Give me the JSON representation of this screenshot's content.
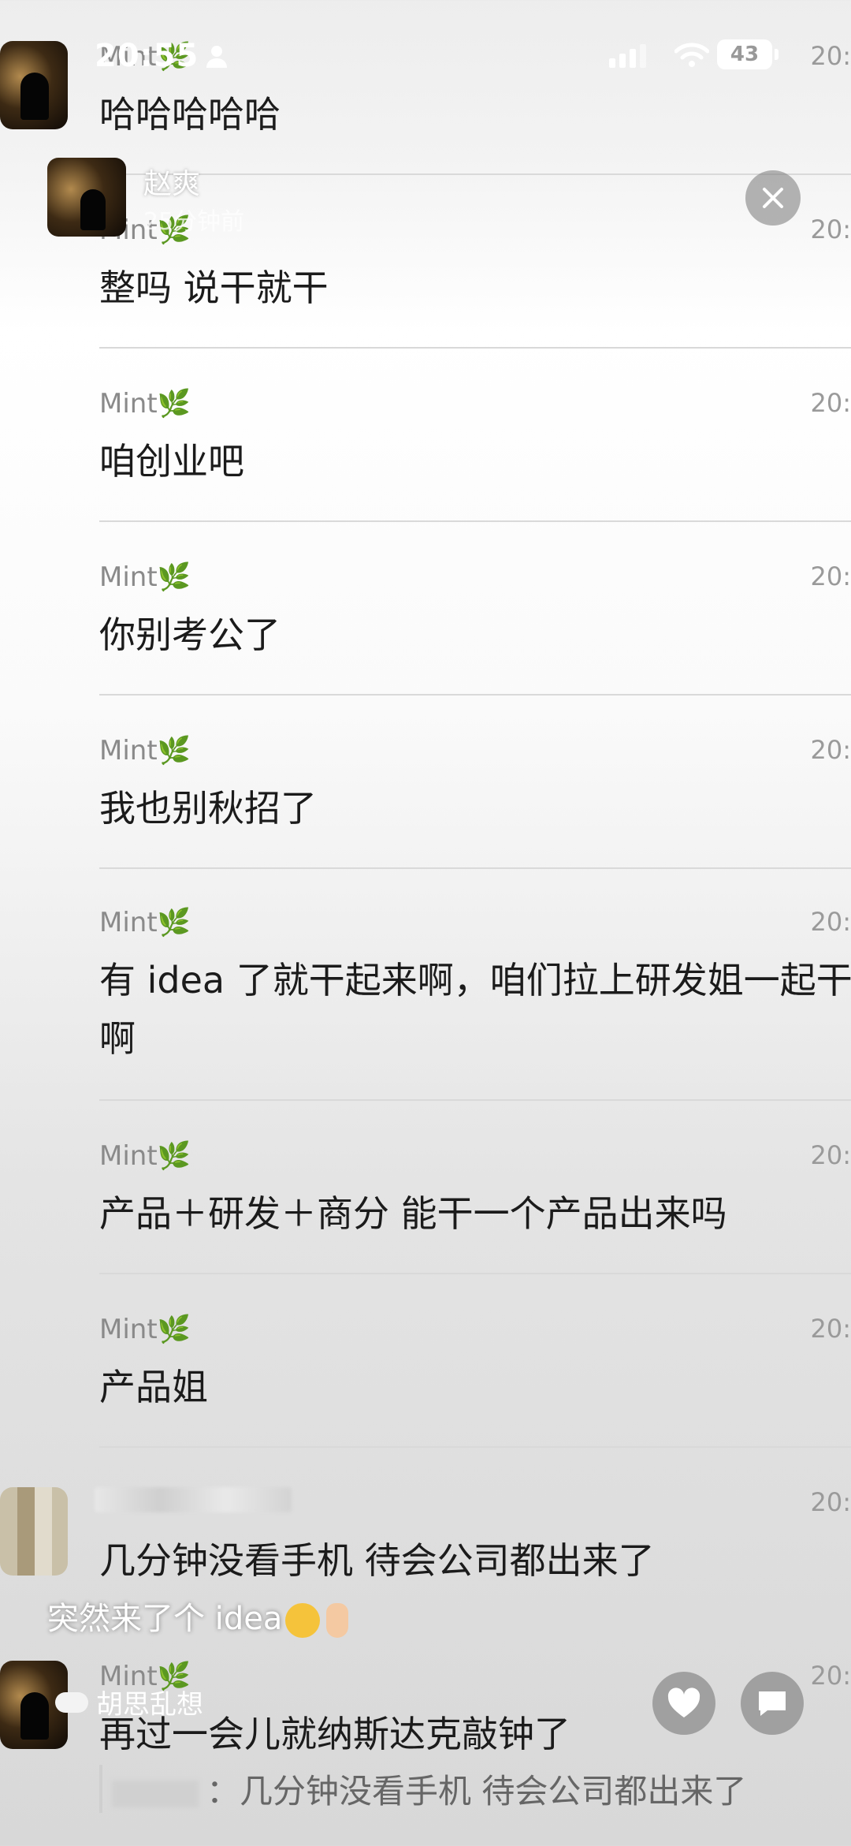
{
  "status_bar": {
    "time": "20:55",
    "battery": "43"
  },
  "overlay": {
    "name": "赵爽",
    "subtitle": "25分钟前",
    "caption": "突然来了个 idea",
    "topic": "胡思乱想"
  },
  "messages": [
    {
      "sender": "Mint",
      "time": "20:",
      "text": "哈哈哈哈哈"
    },
    {
      "sender": "Mint",
      "time": "20:",
      "text": "整吗 说干就干"
    },
    {
      "sender": "Mint",
      "time": "20:",
      "text": "咱创业吧"
    },
    {
      "sender": "Mint",
      "time": "20:",
      "text": "你别考公了"
    },
    {
      "sender": "Mint",
      "time": "20:",
      "text": "我也别秋招了"
    },
    {
      "sender": "Mint",
      "time": "20:",
      "text": "有 idea 了就干起来啊，咱们拉上研发姐一起干啊"
    },
    {
      "sender": "Mint",
      "time": "20:",
      "text": "产品＋研发＋商分 能干一个产品出来吗"
    },
    {
      "sender": "Mint",
      "time": "20:",
      "text": "产品姐"
    },
    {
      "sender": "",
      "time": "20:",
      "text": "几分钟没看手机 待会公司都出来了"
    },
    {
      "sender": "Mint",
      "time": "20:",
      "text": "再过一会儿就纳斯达克敲钟了",
      "quote": "：几分钟没看手机 待会公司都出来了"
    }
  ],
  "icon_names": [
    "person-icon",
    "signal-icon",
    "wifi-icon",
    "battery-icon",
    "leaf-icon",
    "close-icon",
    "heart-icon",
    "comment-icon",
    "cloud-icon"
  ]
}
